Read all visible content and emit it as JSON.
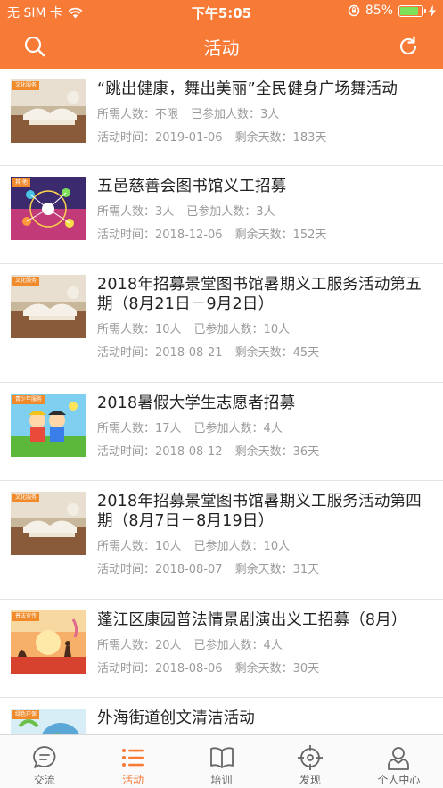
{
  "status": {
    "carrier": "无 SIM 卡",
    "time": "下午5:05",
    "battery": "85%",
    "battery_level": 0.85
  },
  "header": {
    "title": "活动",
    "left_icon": "search-icon",
    "right_icon": "refresh-icon"
  },
  "activities": [
    {
      "title": "“跳出健康，舞出美丽”全民健身广场舞活动",
      "tag": "文化服务",
      "needed": "所需人数：不限",
      "joined": "已参加人数：3人",
      "date": "活动时间：2019-01-06",
      "remaining": "剩余天数：183天"
    },
    {
      "title": "五邑慈善会图书馆义工招募",
      "tag": "其 他",
      "needed": "所需人数：3人",
      "joined": "已参加人数：3人",
      "date": "活动时间：2018-12-06",
      "remaining": "剩余天数：152天"
    },
    {
      "title": "2018年招募景堂图书馆暑期义工服务活动第五期（8月21日－9月2日）",
      "tag": "文化服务",
      "needed": "所需人数：10人",
      "joined": "已参加人数：10人",
      "date": "活动时间：2018-08-21",
      "remaining": "剩余天数：45天"
    },
    {
      "title": "2018暑假大学生志愿者招募",
      "tag": "青少年服务",
      "needed": "所需人数：17人",
      "joined": "已参加人数：4人",
      "date": "活动时间：2018-08-12",
      "remaining": "剩余天数：36天"
    },
    {
      "title": "2018年招募景堂图书馆暑期义工服务活动第四期（8月7日－8月19日）",
      "tag": "文化服务",
      "needed": "所需人数：10人",
      "joined": "已参加人数：10人",
      "date": "活动时间：2018-08-07",
      "remaining": "剩余天数：31天"
    },
    {
      "title": "蓬江区康园普法情景剧演出义工招募（8月）",
      "tag": "普法宣传",
      "needed": "所需人数：20人",
      "joined": "已参加人数：4人",
      "date": "活动时间：2018-08-06",
      "remaining": "剩余天数：30天"
    },
    {
      "title": "外海街道创文清洁活动",
      "tag": "绿色环保",
      "needed": "",
      "joined": "",
      "date": "",
      "remaining": ""
    }
  ],
  "tabbar": [
    {
      "label": "交流",
      "icon": "chat-icon",
      "active": false
    },
    {
      "label": "活动",
      "icon": "list-icon",
      "active": true
    },
    {
      "label": "培训",
      "icon": "book-icon",
      "active": false
    },
    {
      "label": "发现",
      "icon": "target-icon",
      "active": false
    },
    {
      "label": "个人中心",
      "icon": "person-icon",
      "active": false
    }
  ],
  "colors": {
    "accent": "#f77a36",
    "meta_text": "#9a9a9a",
    "tab_inactive": "#666666"
  }
}
